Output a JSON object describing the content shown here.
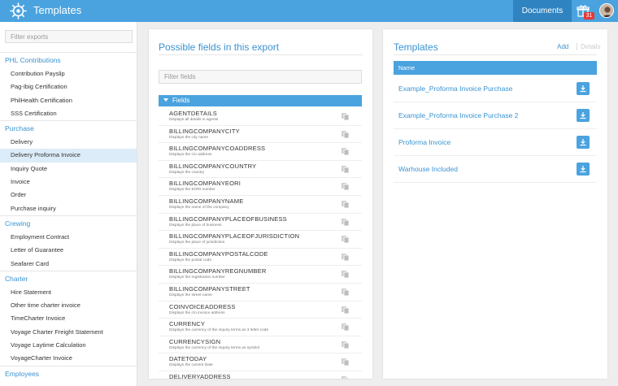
{
  "app": {
    "title": "Templates",
    "nav_documents": "Documents",
    "notifications_count": "31"
  },
  "sidebar": {
    "filter_placeholder": "Filter exports",
    "groups": [
      {
        "label": "PHL Contributions",
        "items": [
          "Contribution Payslip",
          "Pag-Ibig Certification",
          "PhilHealth Certification",
          "SSS Certification"
        ]
      },
      {
        "label": "Purchase",
        "items": [
          "Delivery",
          "Delivery Proforma Invoice",
          "Inquiry Quote",
          "Invoice",
          "Order",
          "Purchase inquiry"
        ]
      },
      {
        "label": "Crewing",
        "items": [
          "Employment Contract",
          "Letter of Guarantee",
          "Seafarer Card"
        ]
      },
      {
        "label": "Charter",
        "items": [
          "Hire Statement",
          "Other time charter invoice",
          "TimeCharter Invoice",
          "Voyage Charter Freight Statement",
          "Voyage Laytime Calculation",
          "VoyageCharter Invoice"
        ]
      },
      {
        "label": "Employees",
        "items": []
      }
    ],
    "active_item": "Delivery Proforma Invoice"
  },
  "fields_panel": {
    "title": "Possible fields in this export",
    "filter_placeholder": "Filter fields",
    "section_label": "Fields",
    "fields": [
      {
        "name": "AGENTDETAILS",
        "desc": "Displays all details in agents"
      },
      {
        "name": "BILLINGCOMPANYCITY",
        "desc": "Displays the city name"
      },
      {
        "name": "BILLINGCOMPANYCOADDRESS",
        "desc": "Displays the c/o address"
      },
      {
        "name": "BILLINGCOMPANYCOUNTRY",
        "desc": "Displays the country"
      },
      {
        "name": "BILLINGCOMPANYEORI",
        "desc": "Displays the EORI number"
      },
      {
        "name": "BILLINGCOMPANYNAME",
        "desc": "Displays the name of the company"
      },
      {
        "name": "BILLINGCOMPANYPLACEOFBUSINESS",
        "desc": "Displays the place of business"
      },
      {
        "name": "BILLINGCOMPANYPLACEOFJURISDICTION",
        "desc": "Displays the place of jurisdiction"
      },
      {
        "name": "BILLINGCOMPANYPOSTALCODE",
        "desc": "Displays the postal code"
      },
      {
        "name": "BILLINGCOMPANYREGNUMBER",
        "desc": "Displays the registration number"
      },
      {
        "name": "BILLINGCOMPANYSTREET",
        "desc": "Displays the street name"
      },
      {
        "name": "COINVOICEADDRESS",
        "desc": "Displays the c/o invoice address"
      },
      {
        "name": "CURRENCY",
        "desc": "Displays the currency of the inquiry terms as 3 letter code"
      },
      {
        "name": "CURRENCYSIGN",
        "desc": "Displays the currency of the inquiry terms as symbol"
      },
      {
        "name": "DATETODAY",
        "desc": "Displays the current Date"
      },
      {
        "name": "DELIVERYADDRESS",
        "desc": ""
      }
    ]
  },
  "templates_panel": {
    "title": "Templates",
    "add_label": "Add",
    "details_label": "Details",
    "column_name": "Name",
    "templates": [
      "Example_Proforma Invoice Purchase",
      "Example_Proforma Invoice Purchase 2",
      "Proforma Invoice",
      "Warhouse Included"
    ]
  },
  "colors": {
    "accent": "#4aa3df",
    "accent_dark": "#2f83c0",
    "badge": "#e53935",
    "active_row": "#dcecf8"
  },
  "icons": {
    "logo": "ship-wheel-icon",
    "notifications": "gift-icon",
    "copy": "copy-icon",
    "download": "download-icon"
  }
}
